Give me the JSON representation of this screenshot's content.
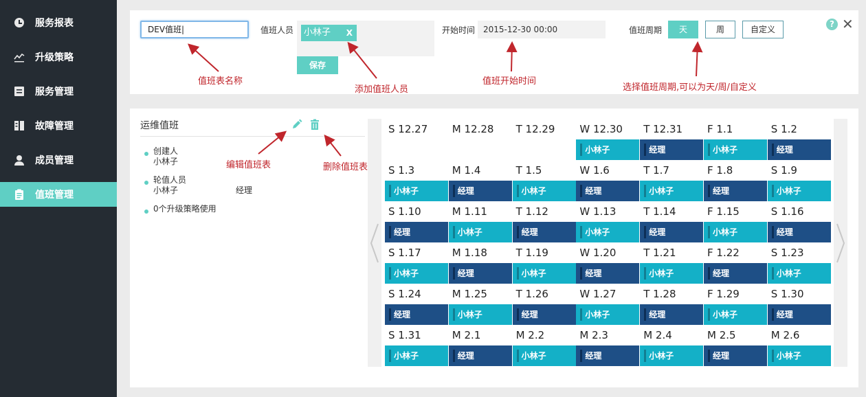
{
  "sidebar": {
    "items": [
      {
        "label": "服务报表",
        "icon": "report-icon",
        "active": false
      },
      {
        "label": "升级策略",
        "icon": "chart-icon",
        "active": false
      },
      {
        "label": "服务管理",
        "icon": "list-icon",
        "active": false
      },
      {
        "label": "故障管理",
        "icon": "fault-icon",
        "active": false
      },
      {
        "label": "成员管理",
        "icon": "user-icon",
        "active": false
      },
      {
        "label": "值班管理",
        "icon": "clipboard-icon",
        "active": true
      }
    ]
  },
  "form": {
    "schedule_name_value": "DEV值班|",
    "members_label": "值班人员",
    "member_tag": "小林子",
    "member_remove": "X",
    "save_label": "保存",
    "start_label": "开始时间",
    "start_value": "2015-12-30 00:00",
    "period_label": "值班周期",
    "period_options": [
      "天",
      "周",
      "自定义"
    ],
    "period_selected": "天"
  },
  "annotations": {
    "name": "值班表名称",
    "members": "添加值班人员",
    "start": "值班开始时间",
    "period": "选择值班周期,可以为天/周/自定义",
    "edit": "编辑值班表",
    "delete": "删除值班表"
  },
  "schedule": {
    "title": "运维值班",
    "creator_label": "创建人",
    "creator_name": "小林子",
    "rotation_label": "轮值人员",
    "rotation_members": [
      "小林子",
      "经理"
    ],
    "policy_usage": "0个升级策略使用"
  },
  "calendar": {
    "weeks": [
      {
        "dates": [
          "S 12.27",
          "M 12.28",
          "T 12.29",
          "W 12.30",
          "T 12.31",
          "F 1.1",
          "S 1.2"
        ],
        "duty": [
          "",
          "",
          "",
          "小林子",
          "经理",
          "小林子",
          "经理"
        ]
      },
      {
        "dates": [
          "S 1.3",
          "M 1.4",
          "T 1.5",
          "W 1.6",
          "T 1.7",
          "F 1.8",
          "S 1.9"
        ],
        "duty": [
          "小林子",
          "经理",
          "小林子",
          "经理",
          "小林子",
          "经理",
          "小林子"
        ]
      },
      {
        "dates": [
          "S 1.10",
          "M 1.11",
          "T 1.12",
          "W 1.13",
          "T 1.14",
          "F 1.15",
          "S 1.16"
        ],
        "duty": [
          "经理",
          "小林子",
          "经理",
          "小林子",
          "经理",
          "小林子",
          "经理"
        ]
      },
      {
        "dates": [
          "S 1.17",
          "M 1.18",
          "T 1.19",
          "W 1.20",
          "T 1.21",
          "F 1.22",
          "S 1.23"
        ],
        "duty": [
          "小林子",
          "经理",
          "小林子",
          "经理",
          "小林子",
          "经理",
          "小林子"
        ]
      },
      {
        "dates": [
          "S 1.24",
          "M 1.25",
          "T 1.26",
          "W 1.27",
          "T 1.28",
          "F 1.29",
          "S 1.30"
        ],
        "duty": [
          "经理",
          "小林子",
          "经理",
          "小林子",
          "经理",
          "小林子",
          "经理"
        ]
      },
      {
        "dates": [
          "S 1.31",
          "M 2.1",
          "M 2.2",
          "M 2.3",
          "M 2.4",
          "M 2.5",
          "M 2.6"
        ],
        "duty": [
          "小林子",
          "经理",
          "小林子",
          "经理",
          "小林子",
          "经理",
          "小林子"
        ]
      }
    ]
  },
  "colors": {
    "accent": "#5fcfc4",
    "sidebar_bg": "#252c33",
    "duty_member": "#14b0c7",
    "duty_manager": "#1e4f86",
    "annotation": "#c0262c"
  }
}
